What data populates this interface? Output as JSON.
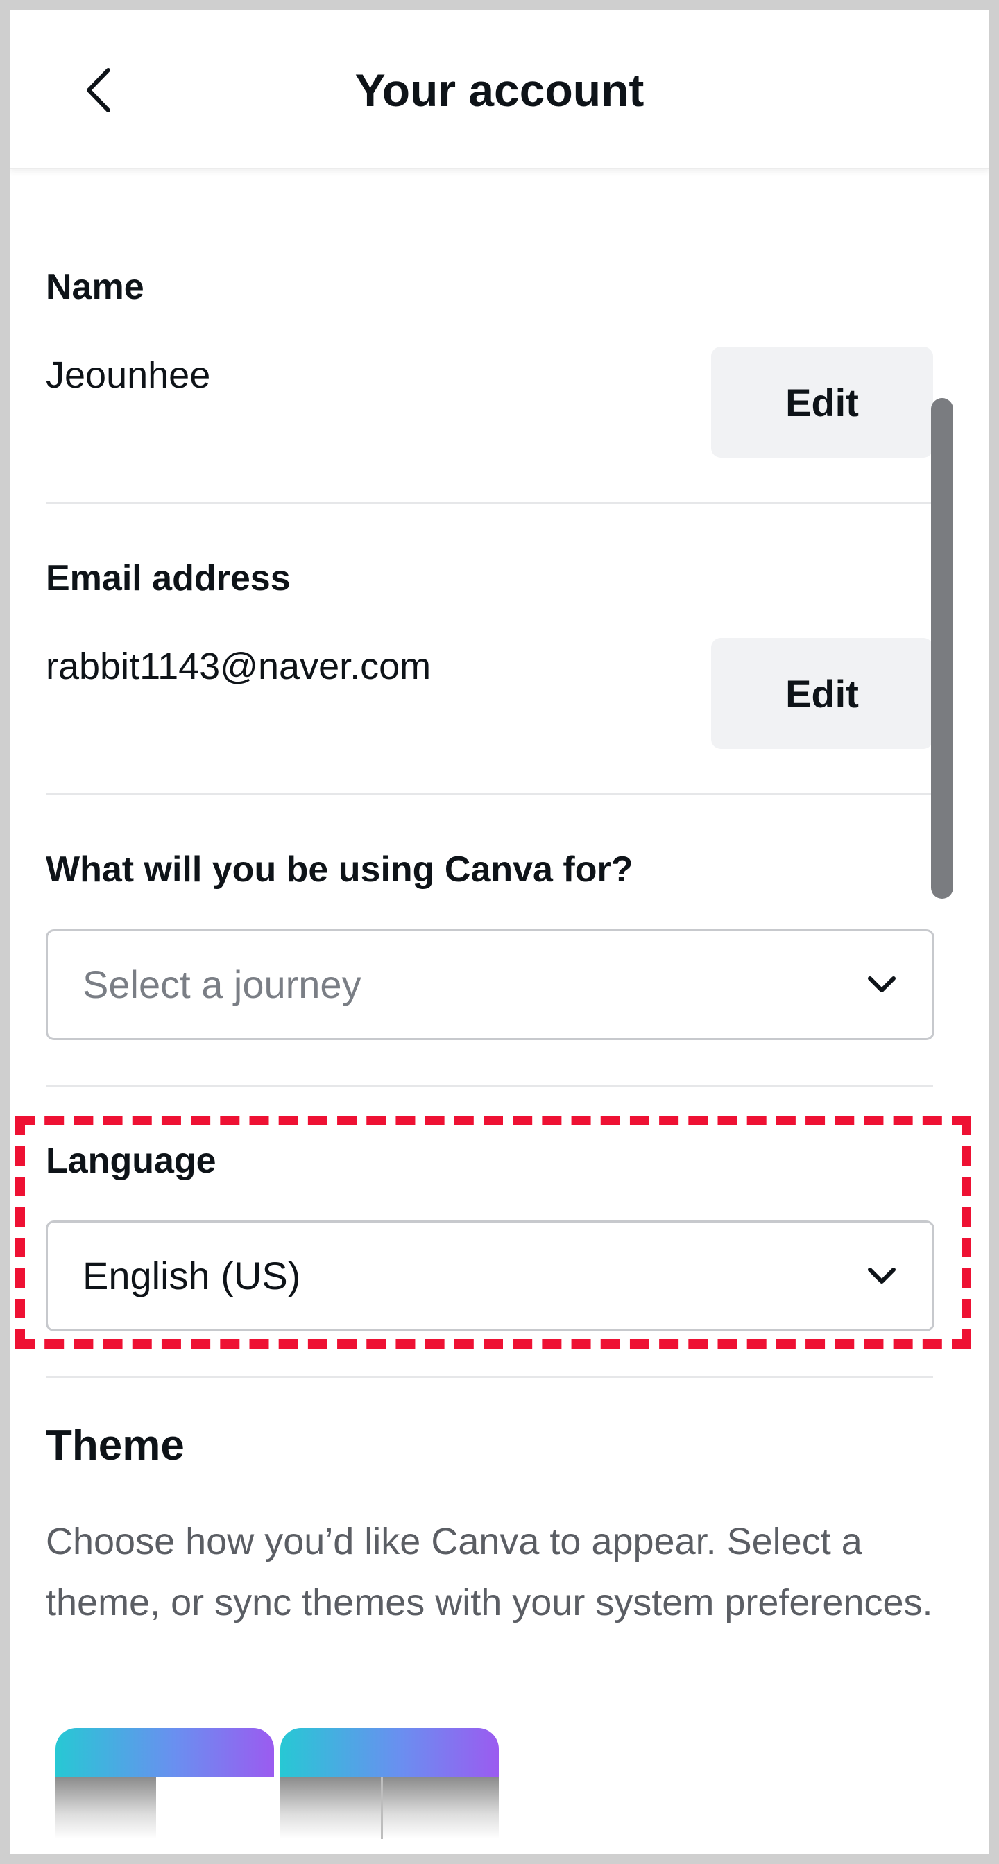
{
  "header": {
    "title": "Your account",
    "back_icon": "chevron-left-icon"
  },
  "name_section": {
    "label": "Name",
    "value": "Jeounhee",
    "edit_label": "Edit"
  },
  "email_section": {
    "label": "Email address",
    "value": "rabbit1143@naver.com",
    "edit_label": "Edit"
  },
  "journey_section": {
    "label": "What will you be using Canva for?",
    "placeholder": "Select a journey",
    "chevron_icon": "chevron-down-icon"
  },
  "language_section": {
    "label": "Language",
    "selected": "English (US)",
    "chevron_icon": "chevron-down-icon"
  },
  "theme_section": {
    "title": "Theme",
    "description": "Choose how you’d like Canva to appear. Select a theme, or sync themes with your system preferences."
  },
  "colors": {
    "highlight": "#ee1133",
    "button_bg": "#f1f2f4",
    "divider": "#e6e7e9",
    "placeholder_text": "#7a7e85"
  }
}
